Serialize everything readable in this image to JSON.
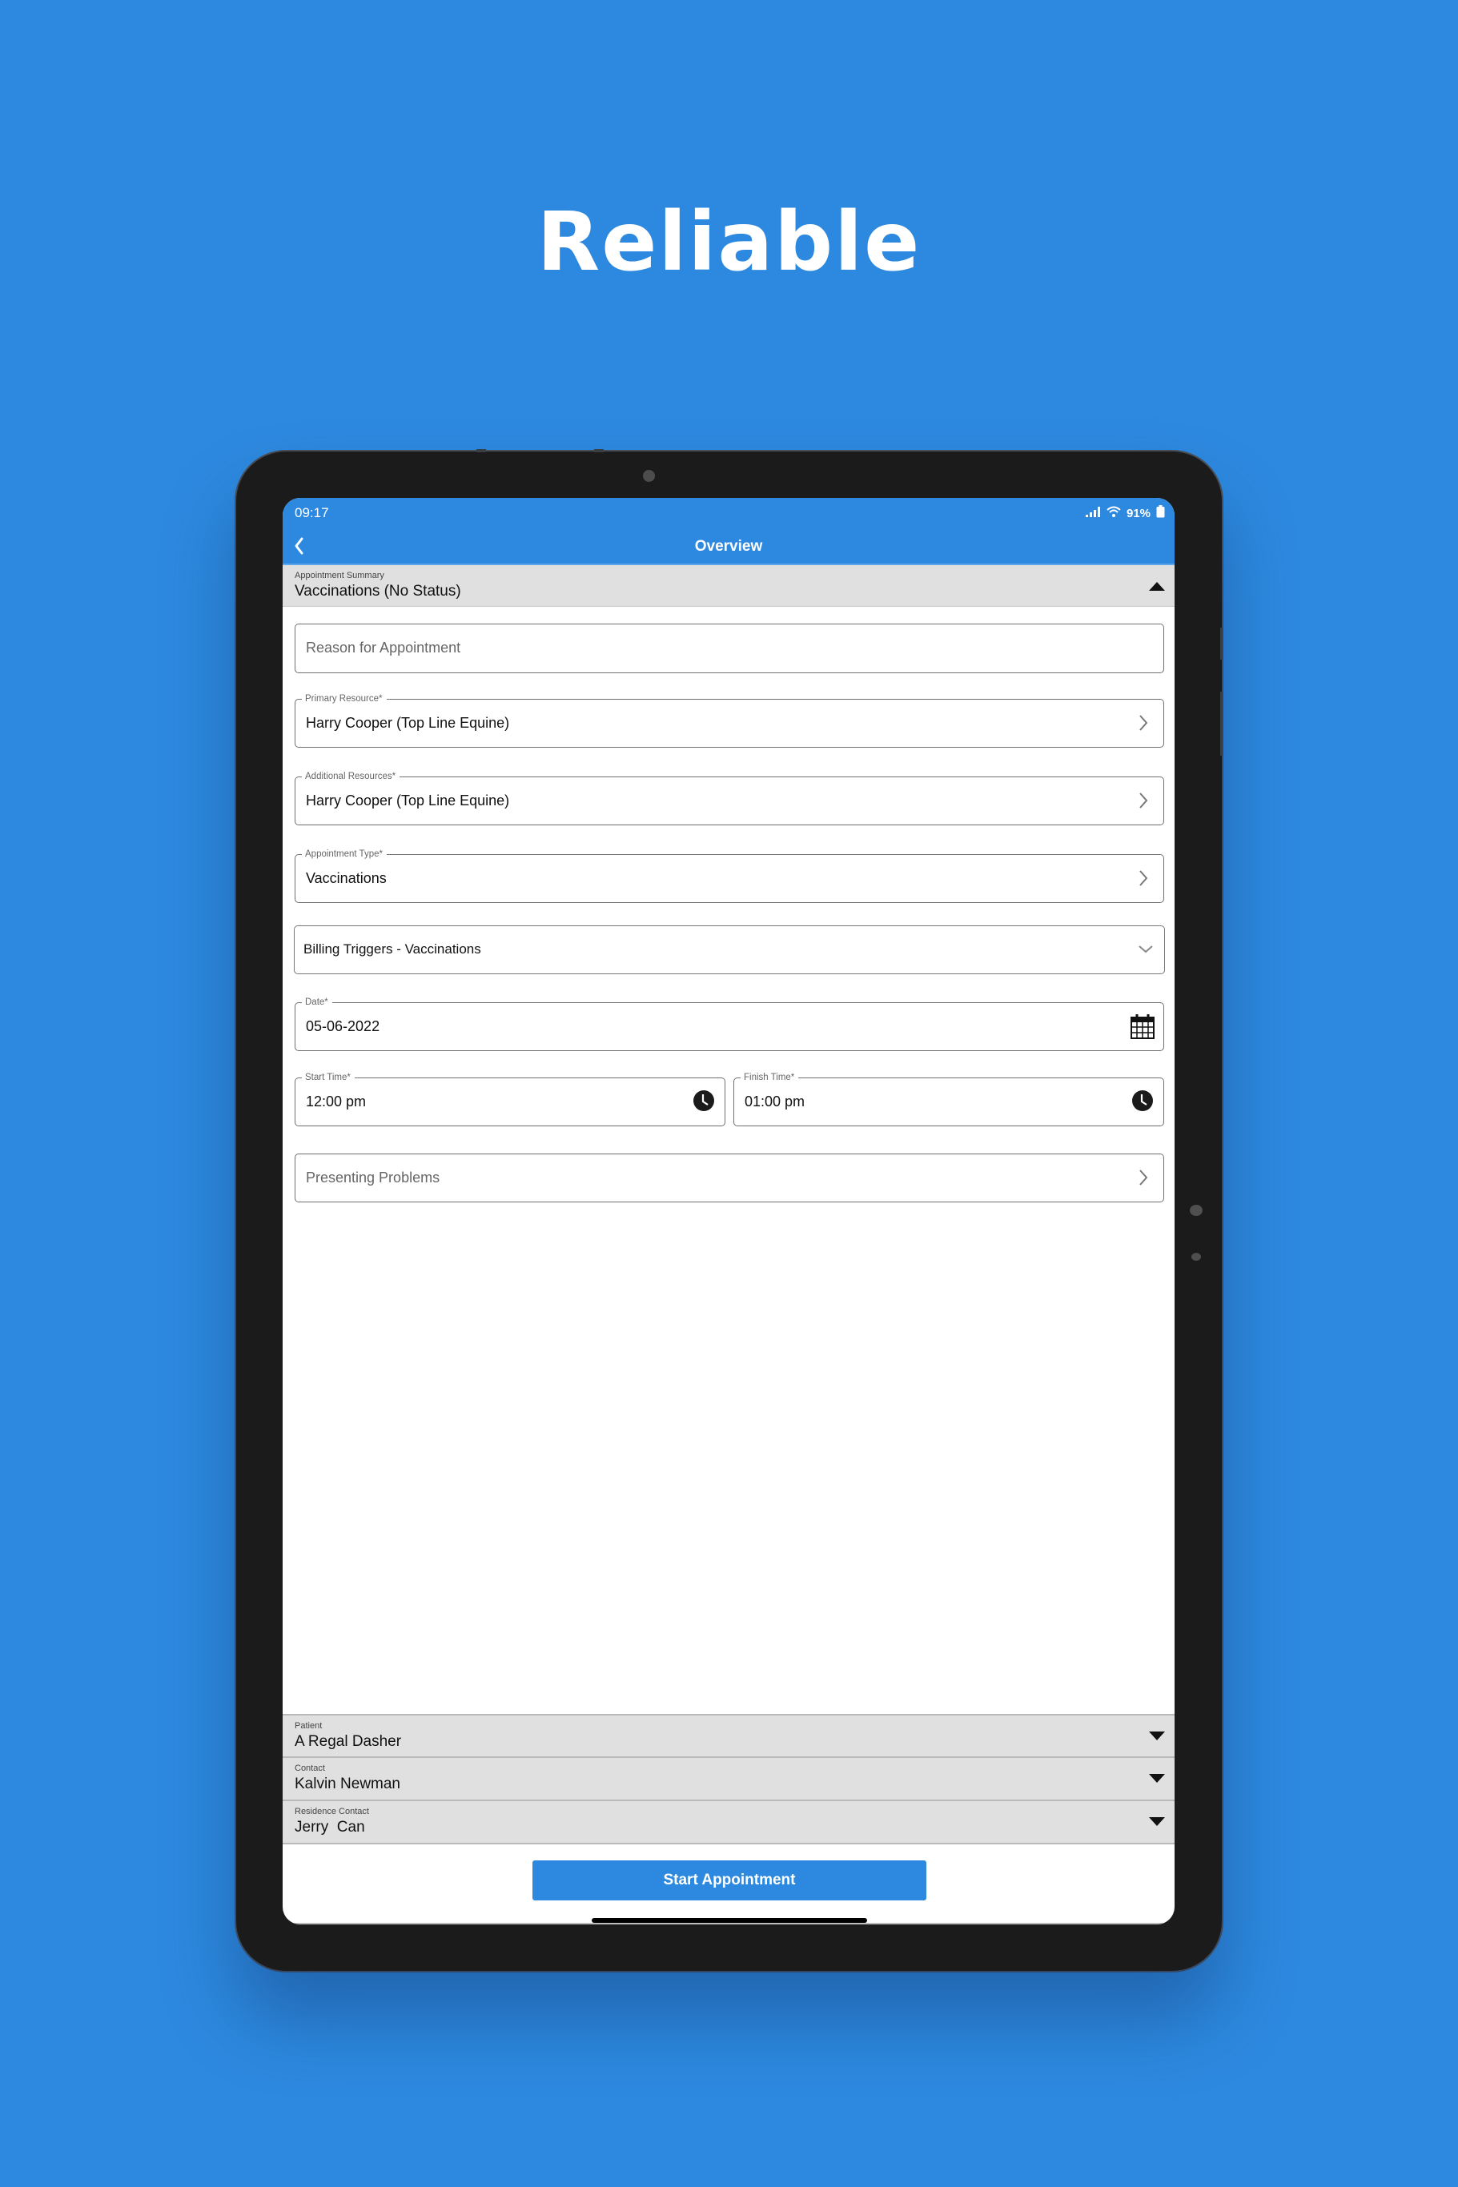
{
  "headline": "Reliable",
  "status_bar": {
    "time": "09:17",
    "battery_percent": "91%",
    "icons": [
      "cellular-signal-icon",
      "wifi-icon",
      "battery-icon"
    ]
  },
  "nav": {
    "title": "Overview",
    "back_icon": "chevron-left-icon"
  },
  "summary": {
    "label": "Appointment Summary",
    "value": "Vaccinations (No Status)",
    "state": "expanded"
  },
  "form": {
    "reason": {
      "placeholder": "Reason for Appointment",
      "value": ""
    },
    "primary_resource": {
      "label": "Primary Resource*",
      "value": "Harry Cooper (Top Line Equine)"
    },
    "additional_resources": {
      "label": "Additional Resources*",
      "value": "Harry Cooper (Top Line Equine)"
    },
    "appointment_type": {
      "label": "Appointment Type*",
      "value": "Vaccinations"
    },
    "billing_triggers": {
      "value": "Billing Triggers - Vaccinations"
    },
    "date": {
      "label": "Date*",
      "value": "05-06-2022"
    },
    "start_time": {
      "label": "Start Time*",
      "value": "12:00 pm"
    },
    "finish_time": {
      "label": "Finish Time*",
      "value": "01:00 pm"
    },
    "presenting_problems": {
      "placeholder": "Presenting Problems"
    }
  },
  "bottom_sections": [
    {
      "label": "Patient",
      "value": "A Regal Dasher"
    },
    {
      "label": "Contact",
      "value": "Kalvin Newman"
    },
    {
      "label": "Residence Contact",
      "value": "Jerry  Can"
    }
  ],
  "actions": {
    "start_appointment": "Start Appointment"
  },
  "colors": {
    "brand_blue": "#2d89df",
    "bar_gray": "#e0e0e0",
    "border_gray": "#6f6f6f"
  }
}
